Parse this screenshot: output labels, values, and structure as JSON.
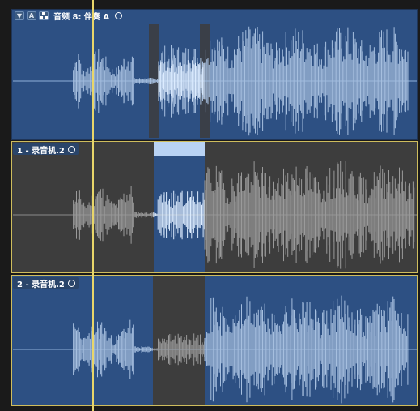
{
  "tracks": {
    "folder": {
      "title": "音频 8: 伴奏 A",
      "a_button": "A",
      "collapse_icon": "triangle-down-icon",
      "group_icon": "take-group-icon"
    },
    "take1": {
      "title": "1 - 录音机.2"
    },
    "take2": {
      "title": "2 - 录音机.2"
    }
  },
  "colors": {
    "region_blue": "#2d5083",
    "inactive_gray": "#3d3d3d",
    "waveform_light": "#a6bfdf",
    "waveform_bright": "#dcecff",
    "waveform_gray": "#9a9a9a",
    "playhead": "#e8d66a",
    "lane_border": "#cfbd5d"
  }
}
